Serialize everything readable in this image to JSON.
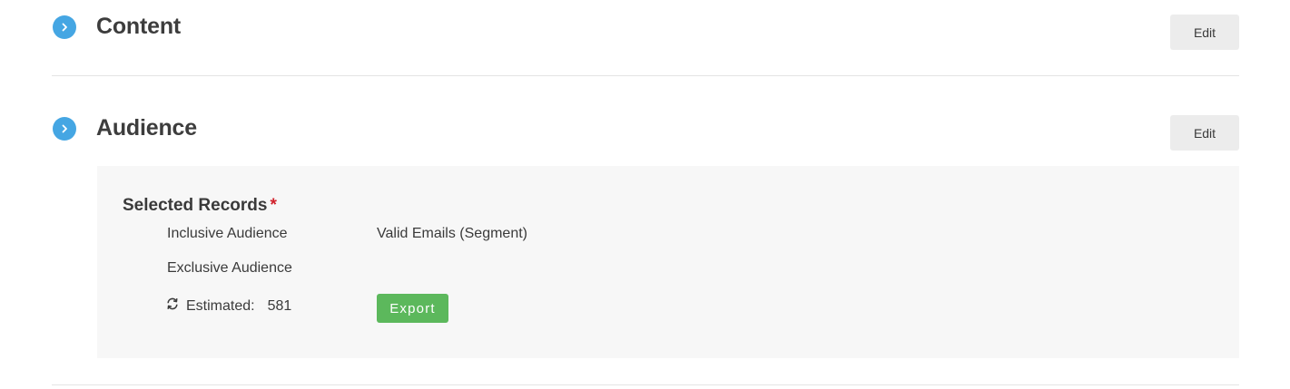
{
  "sections": [
    {
      "title": "Content",
      "edit_label": "Edit",
      "expand_icon": "chevron-right-icon"
    },
    {
      "title": "Audience",
      "edit_label": "Edit",
      "expand_icon": "chevron-right-icon"
    }
  ],
  "audience": {
    "heading": "Selected Records",
    "required_marker": "*",
    "rows": [
      {
        "label": "Inclusive Audience",
        "value": "Valid Emails (Segment)"
      },
      {
        "label": "Exclusive Audience",
        "value": ""
      }
    ],
    "estimated_label": "Estimated:",
    "estimated_count": "581",
    "refresh_icon": "refresh-icon",
    "export_label": "Export"
  },
  "colors": {
    "accent_blue": "#45a6e3",
    "export_green": "#5cb85c",
    "required_red": "#d0202a",
    "panel_background": "#f7f7f7",
    "edit_button_background": "#ececec"
  }
}
